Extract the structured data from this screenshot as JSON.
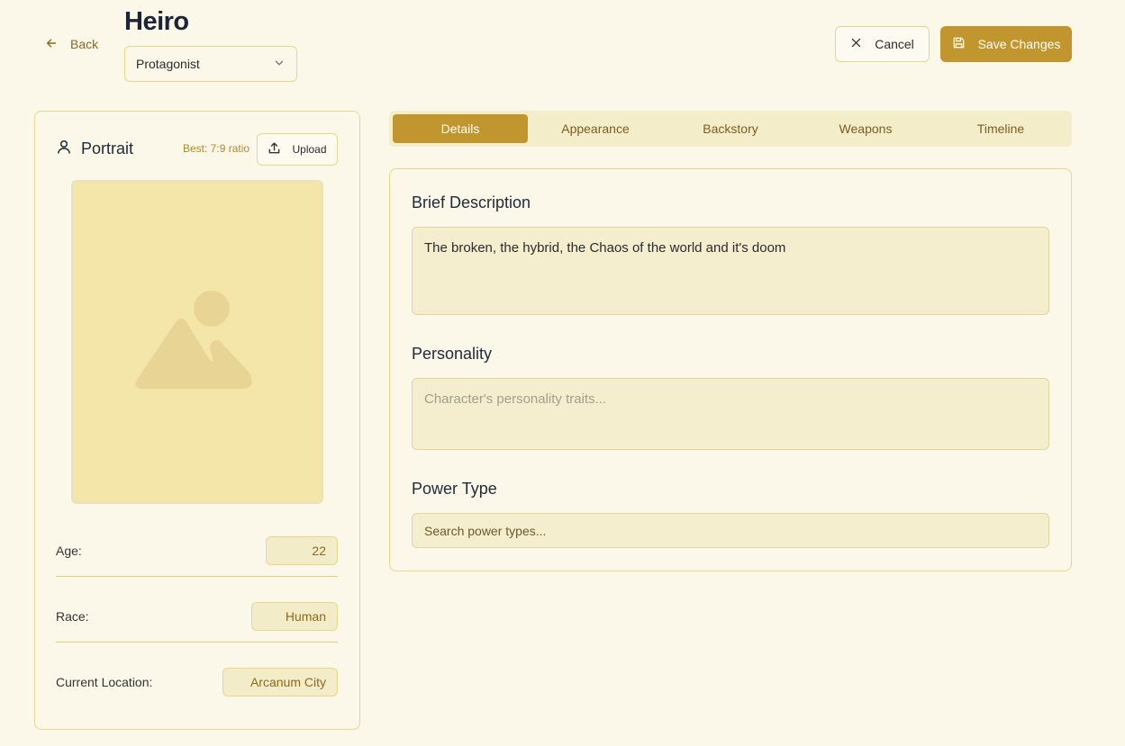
{
  "header": {
    "back_label": "Back",
    "character_name": "Heiro",
    "role_value": "Protagonist",
    "cancel_label": "Cancel",
    "save_label": "Save Changes"
  },
  "portrait": {
    "title": "Portrait",
    "ratio_hint": "Best: 7:9 ratio",
    "upload_label": "Upload"
  },
  "attributes": [
    {
      "label": "Age:",
      "value": "22"
    },
    {
      "label": "Race:",
      "value": "Human"
    },
    {
      "label": "Current Location:",
      "value": "Arcanum City"
    }
  ],
  "tabs": [
    {
      "label": "Details",
      "active": true
    },
    {
      "label": "Appearance",
      "active": false
    },
    {
      "label": "Backstory",
      "active": false
    },
    {
      "label": "Weapons",
      "active": false
    },
    {
      "label": "Timeline",
      "active": false
    }
  ],
  "details": {
    "brief_description_label": "Brief Description",
    "brief_description_value": "The broken, the hybrid, the Chaos of the world and it's doom",
    "personality_label": "Personality",
    "personality_placeholder": "Character's personality traits...",
    "power_type_label": "Power Type",
    "power_type_placeholder": "Search power types..."
  },
  "colors": {
    "background": "#fbf8ea",
    "accent": "#c2962e",
    "border": "#e7d68c",
    "field_bg": "#f4eecf"
  }
}
